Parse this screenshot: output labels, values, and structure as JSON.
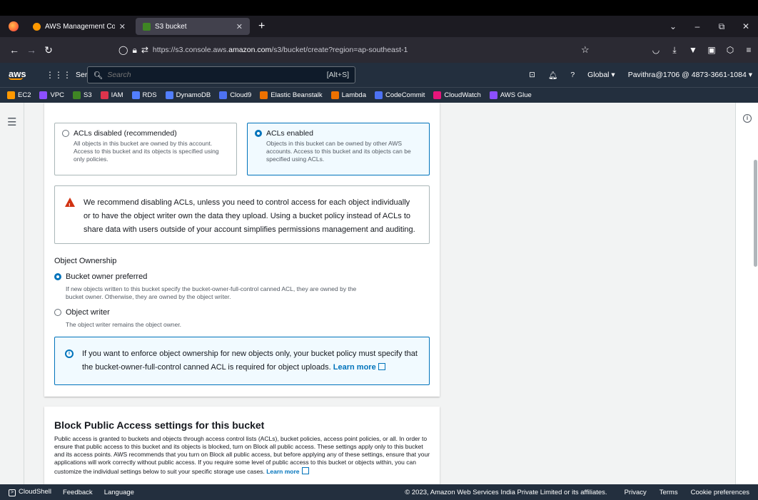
{
  "browser": {
    "tabs": [
      {
        "title": "AWS Management Console",
        "favicon_color": "#ff9900",
        "active": false
      },
      {
        "title": "S3 bucket",
        "favicon_color": "#3f8624",
        "active": true
      }
    ],
    "new_tab": "+",
    "url_prefix": "https://s3.console.aws.",
    "url_domain": "amazon.com",
    "url_path": "/s3/bucket/create?region=ap-southeast-1",
    "window_controls": [
      "⌄",
      "–",
      "⧉",
      "✕"
    ]
  },
  "aws_header": {
    "logo": "aws",
    "services_label": "Services",
    "search_placeholder": "Search",
    "search_shortcut": "[Alt+S]",
    "region": "Global ▾",
    "account": "Pavithra@1706 @ 4873-3661-1084 ▾"
  },
  "favorites": [
    {
      "label": "EC2",
      "color": "#ff9900"
    },
    {
      "label": "VPC",
      "color": "#8c4fff"
    },
    {
      "label": "S3",
      "color": "#3f8624"
    },
    {
      "label": "IAM",
      "color": "#dd344c"
    },
    {
      "label": "RDS",
      "color": "#527fff"
    },
    {
      "label": "DynamoDB",
      "color": "#527fff"
    },
    {
      "label": "Cloud9",
      "color": "#4d72f3"
    },
    {
      "label": "Elastic Beanstalk",
      "color": "#ed7100"
    },
    {
      "label": "Lambda",
      "color": "#ed7100"
    },
    {
      "label": "CodeCommit",
      "color": "#4d72f3"
    },
    {
      "label": "CloudWatch",
      "color": "#e7157b"
    },
    {
      "label": "AWS Glue",
      "color": "#8c4fff"
    }
  ],
  "acl": {
    "disabled_title": "ACLs disabled (recommended)",
    "disabled_desc": "All objects in this bucket are owned by this account. Access to this bucket and its objects is specified using only policies.",
    "enabled_title": "ACLs enabled",
    "enabled_desc": "Objects in this bucket can be owned by other AWS accounts. Access to this bucket and its objects can be specified using ACLs.",
    "warning": "We recommend disabling ACLs, unless you need to control access for each object individually or to have the object writer own the data they upload. Using a bucket policy instead of ACLs to share data with users outside of your account simplifies permissions management and auditing."
  },
  "ownership": {
    "label": "Object Ownership",
    "option1": "Bucket owner preferred",
    "option1_desc": "If new objects written to this bucket specify the bucket-owner-full-control canned ACL, they are owned by the bucket owner. Otherwise, they are owned by the object writer.",
    "option2": "Object writer",
    "option2_desc": "The object writer remains the object owner.",
    "info_text": "If you want to enforce object ownership for new objects only, your bucket policy must specify that the bucket-owner-full-control canned ACL is required for object uploads.",
    "learn_more": "Learn more"
  },
  "bpa": {
    "title": "Block Public Access settings for this bucket",
    "text": "Public access is granted to buckets and objects through access control lists (ACLs), bucket policies, access point policies, or all. In order to ensure that public access to this bucket and its objects is blocked, turn on Block all public access. These settings apply only to this bucket and its access points. AWS recommends that you turn on Block all public access, but before applying any of these settings, ensure that your applications will work correctly without public access. If you require some level of public access to this bucket or objects within, you can customize the individual settings below to suit your specific storage use cases.",
    "learn_more": "Learn more"
  },
  "footer": {
    "cloudshell": "CloudShell",
    "feedback": "Feedback",
    "language": "Language",
    "copyright": "© 2023, Amazon Web Services India Private Limited or its affiliates.",
    "privacy": "Privacy",
    "terms": "Terms",
    "cookies": "Cookie preferences"
  }
}
